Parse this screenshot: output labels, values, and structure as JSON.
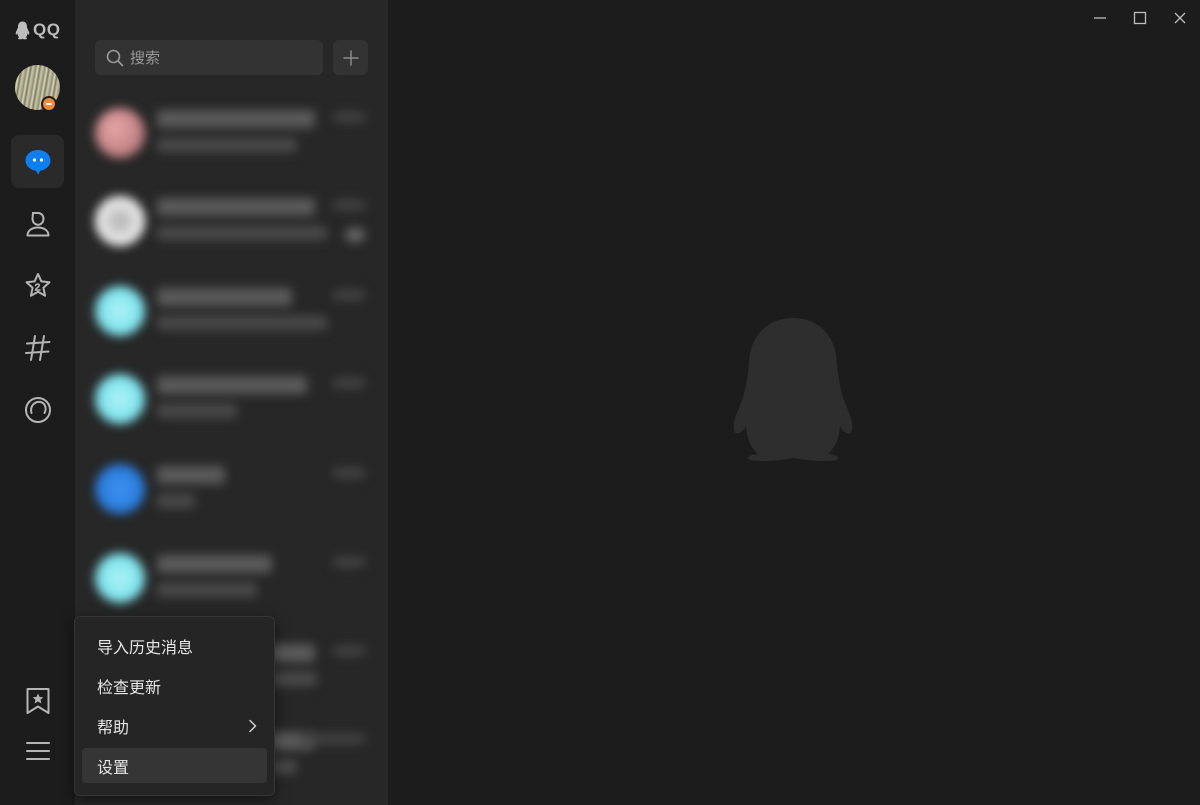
{
  "app": {
    "logo_text": "QQ"
  },
  "nav": {
    "items": [
      {
        "icon": "chat-bubble-icon",
        "active": true
      },
      {
        "icon": "contacts-icon",
        "active": false
      },
      {
        "icon": "star-icon",
        "active": false
      },
      {
        "icon": "hashtag-icon",
        "active": false
      },
      {
        "icon": "circle-icon",
        "active": false
      }
    ],
    "bottom": [
      {
        "icon": "bookmark-star-icon"
      },
      {
        "icon": "menu-icon"
      }
    ]
  },
  "search": {
    "placeholder": "搜索"
  },
  "menu": {
    "items": [
      {
        "label": "导入历史消息",
        "has_submenu": false
      },
      {
        "label": "检查更新",
        "has_submenu": false
      },
      {
        "label": "帮助",
        "has_submenu": true
      },
      {
        "label": "设置",
        "has_submenu": false,
        "highlighted": true
      }
    ]
  },
  "colors": {
    "accent": "#0e7ff0",
    "rail_bg": "#1c1c1c",
    "list_bg": "#272727",
    "main_bg": "#1c1c1c"
  }
}
